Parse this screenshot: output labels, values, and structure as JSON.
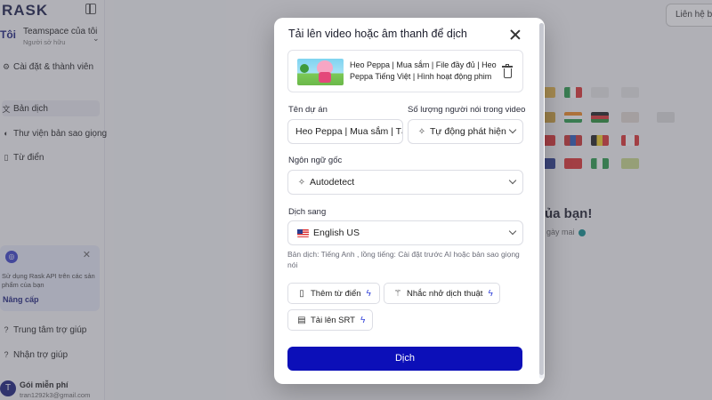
{
  "app": {
    "logo": "RASK",
    "team": {
      "avatar_text": "Tôi",
      "name": "Teamspace của tôi",
      "role": "Người sở hữu"
    },
    "nav": [
      {
        "label": "Cài đặt & thành viên",
        "icon": "gear-icon"
      },
      {
        "label": "Bản dịch",
        "icon": "translate-icon"
      },
      {
        "label": "Thư viện bản sao giọng",
        "icon": "voice-library-icon"
      },
      {
        "label": "Từ điển",
        "icon": "book-icon"
      }
    ],
    "promo": {
      "text": "Sử dụng Rask API trên các sản phẩm của bạn",
      "link": "Nâng cấp"
    },
    "help": [
      {
        "label": "Trung tâm trợ giúp",
        "icon": "help-icon"
      },
      {
        "label": "Nhận trợ giúp",
        "icon": "question-icon"
      }
    ],
    "user": {
      "avatar": "T",
      "plan": "Gói miễn phí",
      "email": "tran1292k3@gmail.com"
    },
    "header": {
      "contact_button": "Liên hệ bá"
    },
    "background": {
      "heading": "ủa bạn!",
      "subtext": "gày mai"
    }
  },
  "modal": {
    "title": "Tải lên video hoặc âm thanh để dịch",
    "video": {
      "title": "Heo Peppa | Mua sắm | File đầy đủ | Heo Peppa Tiếng Việt | Hình hoạt động phim"
    },
    "project_name": {
      "label": "Tên dự án",
      "value": "Heo Peppa | Mua sắm | Tập"
    },
    "speakers": {
      "label": "Số lượng người nói trong video",
      "value": "Tự động phát hiện"
    },
    "source_language": {
      "label": "Ngôn ngữ gốc",
      "value": "Autodetect"
    },
    "target_language": {
      "label": "Dịch sang",
      "value": "English US"
    },
    "hint": "Bản dịch: Tiếng Anh , lồng tiếng: Cài đặt trước AI hoặc bản sao giọng nói",
    "chips": {
      "add_dictionary": "Thêm từ điển",
      "translation_reminder": "Nhắc nhở dịch thuật",
      "upload_srt": "Tải lên SRT"
    },
    "submit": "Dịch"
  },
  "colors": {
    "primary": "#0c0fb8",
    "accent_bolt": "#2f3fd8",
    "overlay": "#50525c"
  }
}
